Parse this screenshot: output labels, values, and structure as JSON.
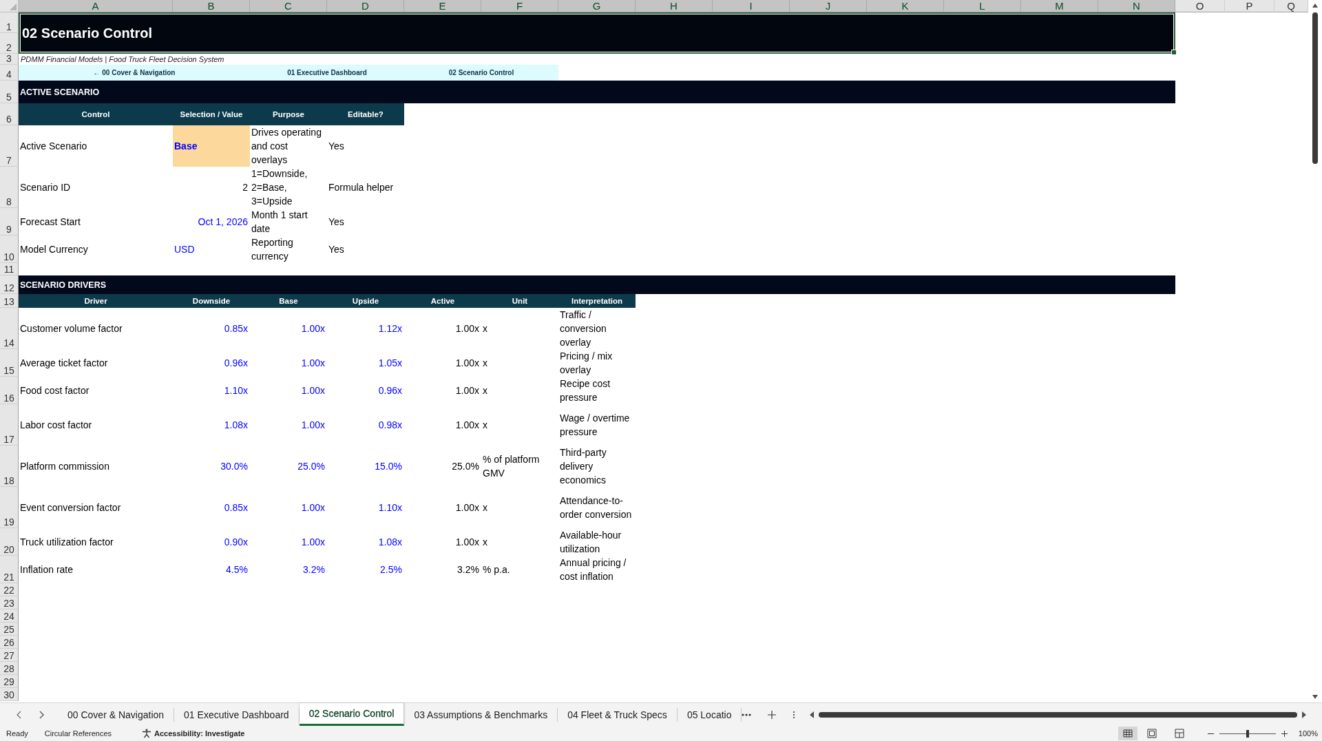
{
  "column_headers": [
    {
      "label": "A",
      "selected": true
    },
    {
      "label": "B",
      "selected": true
    },
    {
      "label": "C",
      "selected": true
    },
    {
      "label": "D",
      "selected": true
    },
    {
      "label": "E",
      "selected": true
    },
    {
      "label": "F",
      "selected": true
    },
    {
      "label": "G",
      "selected": true
    },
    {
      "label": "H",
      "selected": true
    },
    {
      "label": "I",
      "selected": true
    },
    {
      "label": "J",
      "selected": true
    },
    {
      "label": "K",
      "selected": true
    },
    {
      "label": "L",
      "selected": true
    },
    {
      "label": "M",
      "selected": true
    },
    {
      "label": "N",
      "selected": true
    },
    {
      "label": "O",
      "selected": false
    },
    {
      "label": "P",
      "selected": false
    },
    {
      "label": "Q",
      "selected": false
    }
  ],
  "row_headers": [
    "1",
    "2",
    "3",
    "4",
    "5",
    "6",
    "7",
    "8",
    "9",
    "10",
    "11",
    "12",
    "13",
    "14",
    "15",
    "16",
    "17",
    "18",
    "19",
    "20",
    "21",
    "22",
    "23",
    "24",
    "25",
    "26",
    "27",
    "28",
    "29",
    "30"
  ],
  "title": "02 Scenario Control",
  "subtitle": "PDMM Financial Models | Food Truck Fleet Decision System",
  "nav_links": [
    "← 00 Cover & Navigation",
    "01 Executive Dashboard",
    "02 Scenario Control"
  ],
  "active_scenario": {
    "heading": "ACTIVE SCENARIO",
    "columns": [
      "Control",
      "Selection / Value",
      "Purpose",
      "Editable?"
    ],
    "rows": [
      {
        "control": "Active Scenario",
        "value": "Base",
        "kind": "selection",
        "purpose": "Drives operating and cost overlays",
        "editable": "Yes"
      },
      {
        "control": "Scenario ID",
        "value": "2",
        "kind": "formula",
        "purpose": "1=Downside, 2=Base, 3=Upside",
        "editable": "Formula helper"
      },
      {
        "control": "Forecast Start",
        "value": "Oct 1, 2026",
        "kind": "date",
        "purpose": "Month 1 start date",
        "editable": "Yes"
      },
      {
        "control": "Model Currency",
        "value": "USD",
        "kind": "text",
        "purpose": "Reporting currency",
        "editable": "Yes"
      }
    ]
  },
  "scenario_drivers": {
    "heading": "SCENARIO DRIVERS",
    "columns": [
      "Driver",
      "Downside",
      "Base",
      "Upside",
      "Active",
      "Unit",
      "Interpretation"
    ],
    "rows": [
      {
        "driver": "Customer volume factor",
        "downside": "0.85x",
        "base": "1.00x",
        "upside": "1.12x",
        "active": "1.00x",
        "unit": "x",
        "interpretation": "Traffic / conversion overlay"
      },
      {
        "driver": "Average ticket factor",
        "downside": "0.96x",
        "base": "1.00x",
        "upside": "1.05x",
        "active": "1.00x",
        "unit": "x",
        "interpretation": "Pricing / mix overlay"
      },
      {
        "driver": "Food cost factor",
        "downside": "1.10x",
        "base": "1.00x",
        "upside": "0.96x",
        "active": "1.00x",
        "unit": "x",
        "interpretation": "Recipe cost pressure"
      },
      {
        "driver": "Labor cost factor",
        "downside": "1.08x",
        "base": "1.00x",
        "upside": "0.98x",
        "active": "1.00x",
        "unit": "x",
        "interpretation": "Wage / overtime pressure"
      },
      {
        "driver": "Platform commission",
        "downside": "30.0%",
        "base": "25.0%",
        "upside": "15.0%",
        "active": "25.0%",
        "unit": "% of platform GMV",
        "interpretation": "Third-party delivery economics"
      },
      {
        "driver": "Event conversion factor",
        "downside": "0.85x",
        "base": "1.00x",
        "upside": "1.10x",
        "active": "1.00x",
        "unit": "x",
        "interpretation": "Attendance-to-order conversion"
      },
      {
        "driver": "Truck utilization factor",
        "downside": "0.90x",
        "base": "1.00x",
        "upside": "1.08x",
        "active": "1.00x",
        "unit": "x",
        "interpretation": "Available-hour utilization"
      },
      {
        "driver": "Inflation rate",
        "downside": "4.5%",
        "base": "3.2%",
        "upside": "2.5%",
        "active": "3.2%",
        "unit": "% p.a.",
        "interpretation": "Annual pricing / cost inflation"
      }
    ]
  },
  "sheet_tabs": [
    {
      "label": "00 Cover & Navigation",
      "selected": false
    },
    {
      "label": "01 Executive Dashboard",
      "selected": false
    },
    {
      "label": "02 Scenario Control",
      "selected": true
    },
    {
      "label": "03 Assumptions & Benchmarks",
      "selected": false
    },
    {
      "label": "04 Fleet & Truck Specs",
      "selected": false
    },
    {
      "label": "05 Locatio",
      "selected": false
    }
  ],
  "status_bar": {
    "mode": "Ready",
    "circular": "Circular References",
    "accessibility": "Accessibility: Investigate",
    "zoom": "100%",
    "zoom_slider": {
      "level": 0.5
    }
  }
}
